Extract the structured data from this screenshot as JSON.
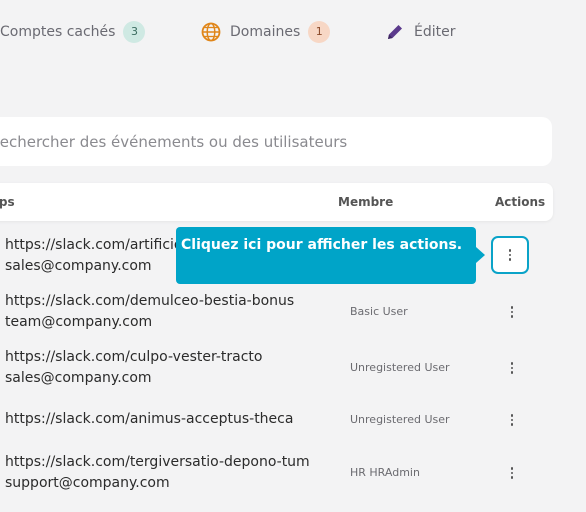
{
  "tabs": [
    {
      "label": "Comptes cachés",
      "badge": "3",
      "icon": "none"
    },
    {
      "label": "Domaines",
      "badge": "1",
      "icon": "globe-icon"
    },
    {
      "label": "Éditer",
      "icon": "pencil-icon"
    }
  ],
  "search": {
    "placeholder": "Rechercher des événements ou des utilisateurs"
  },
  "table": {
    "headers": {
      "apps": "Apps",
      "member": "Membre",
      "actions": "Actions"
    },
    "rows": [
      {
        "url": "https://slack.com/artificio",
        "email": "sales@company.com",
        "member": ""
      },
      {
        "url": "https://slack.com/demulceo-bestia-bonus",
        "email": "team@company.com",
        "member": "Basic User"
      },
      {
        "url": "https://slack.com/culpo-vester-tracto",
        "email": "sales@company.com",
        "member": "Unregistered User"
      },
      {
        "url": "https://slack.com/animus-acceptus-theca",
        "email": "",
        "member": "Unregistered User"
      },
      {
        "url": "https://slack.com/tergiversatio-depono-tum",
        "email": "support@company.com",
        "member": "HR HRAdmin"
      }
    ]
  },
  "tooltip": {
    "text": "Cliquez ici pour afficher les actions."
  },
  "colors": {
    "accent": "#00a4c8",
    "badge_green": "#cfe9e3",
    "badge_orange": "#f7d7c5",
    "pencil": "#5b3a8c",
    "globe": "#e0861a"
  }
}
